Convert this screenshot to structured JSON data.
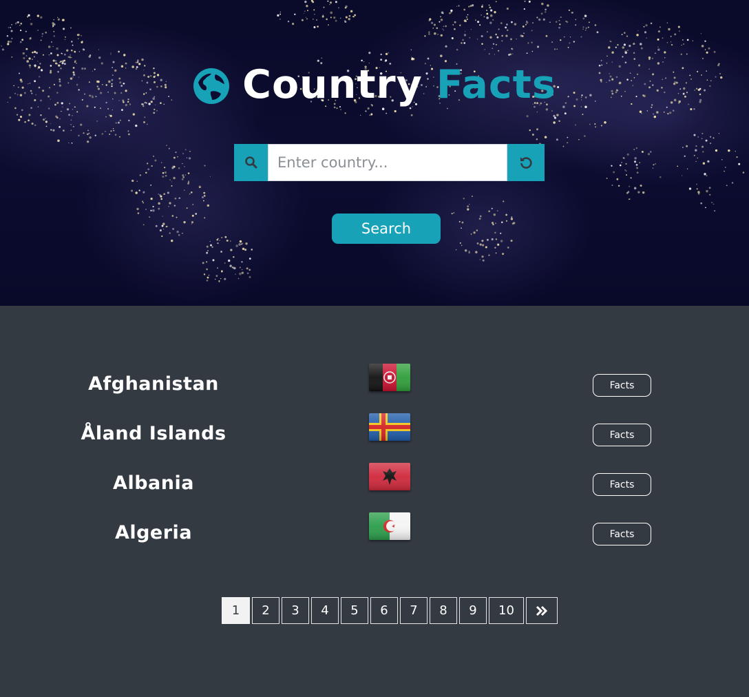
{
  "header": {
    "title_part1": "Country",
    "title_part2": "Facts",
    "accent_color": "#17a2b8",
    "icon": "globe-europe-icon"
  },
  "search": {
    "placeholder": "Enter country...",
    "value": "",
    "left_icon": "search-icon",
    "right_icon": "undo-icon",
    "button_label": "Search"
  },
  "countries": [
    {
      "name": "Afghanistan",
      "flag": "afghanistan-flag",
      "button_label": "Facts"
    },
    {
      "name": "Åland Islands",
      "flag": "aland-islands-flag",
      "button_label": "Facts"
    },
    {
      "name": "Albania",
      "flag": "albania-flag",
      "button_label": "Facts"
    },
    {
      "name": "Algeria",
      "flag": "algeria-flag",
      "button_label": "Facts"
    }
  ],
  "pagination": {
    "active_page": "1",
    "pages": [
      "1",
      "2",
      "3",
      "4",
      "5",
      "6",
      "7",
      "8",
      "9",
      "10"
    ],
    "next_icon": "double-chevron-right-icon"
  }
}
